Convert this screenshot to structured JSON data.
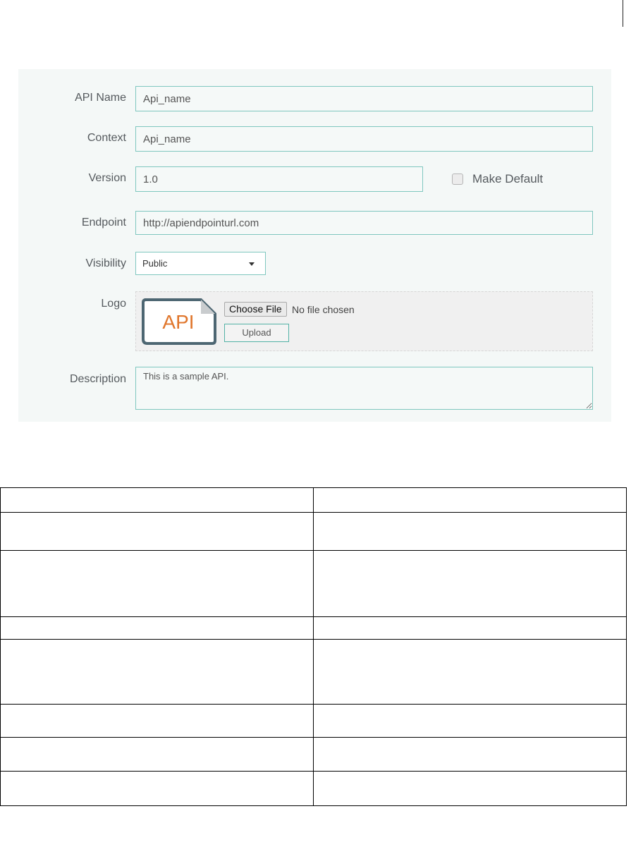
{
  "form": {
    "api_name": {
      "label": "API Name",
      "value": "Api_name"
    },
    "context": {
      "label": "Context",
      "value": "Api_name"
    },
    "version": {
      "label": "Version",
      "value": "1.0",
      "make_default_label": "Make Default",
      "make_default_checked": false
    },
    "endpoint": {
      "label": "Endpoint",
      "value": "http://apiendpointurl.com"
    },
    "visibility": {
      "label": "Visibility",
      "selected": "Public"
    },
    "logo": {
      "label": "Logo",
      "logo_text": "API",
      "choose_file_label": "Choose File",
      "no_file_text": "No file chosen",
      "upload_label": "Upload"
    },
    "description": {
      "label": "Description",
      "value": "This is a sample API."
    }
  },
  "colors": {
    "panel_bg": "#f4f8f7",
    "input_border": "#7fc7bf",
    "logo_accent": "#e0762c",
    "logo_frame": "#4d6672"
  },
  "table": {
    "rows": [
      [
        "",
        ""
      ],
      [
        "",
        ""
      ],
      [
        "",
        ""
      ],
      [
        "",
        ""
      ],
      [
        "",
        ""
      ],
      [
        "",
        ""
      ],
      [
        "",
        ""
      ],
      [
        "",
        ""
      ]
    ]
  }
}
